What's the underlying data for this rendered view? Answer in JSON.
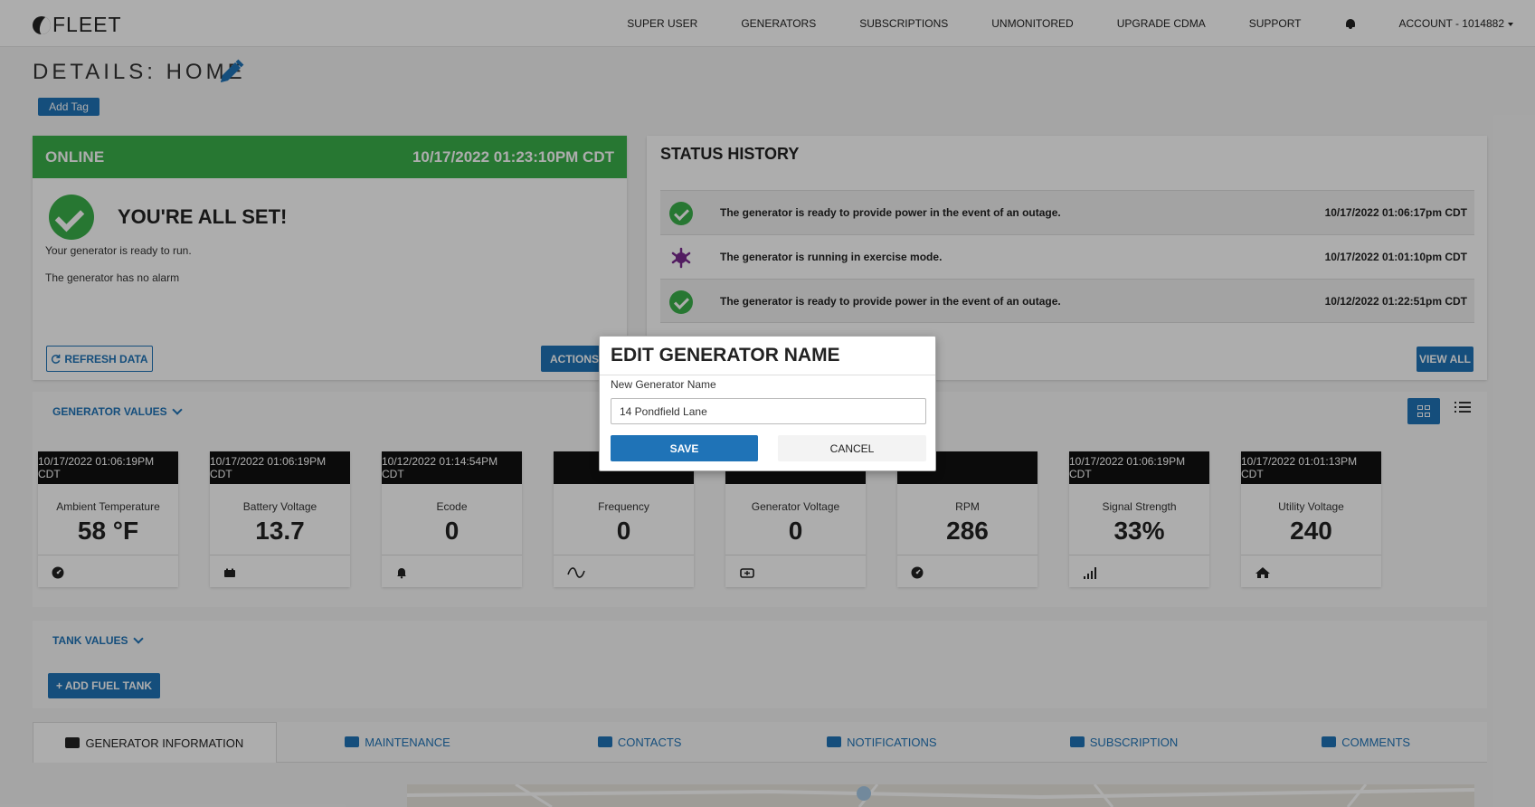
{
  "nav": {
    "logo": "FLEET",
    "items": [
      "SUPER USER",
      "GENERATORS",
      "SUBSCRIPTIONS",
      "UNMONITORED",
      "UPGRADE CDMA",
      "SUPPORT"
    ],
    "account": "ACCOUNT - 1014882"
  },
  "page": {
    "title": "DETAILS: HOME",
    "add_tag": "Add Tag"
  },
  "status_card": {
    "status": "ONLINE",
    "timestamp": "10/17/2022 01:23:10PM CDT",
    "headline": "YOU'RE ALL SET!",
    "ready_text": "Your generator is ready to run.",
    "alarm_text": "The generator has no alarm",
    "refresh_label": "REFRESH DATA",
    "actions_label": "ACTIONS",
    "status_color": "#3ab04a"
  },
  "status_history": {
    "title": "STATUS HISTORY",
    "view_all": "VIEW ALL",
    "rows": [
      {
        "icon": "check-icon",
        "text": "The generator is ready to provide power in the event of an outage.",
        "time": "10/17/2022 01:06:17pm CDT"
      },
      {
        "icon": "exercise-icon",
        "text": "The generator is running in exercise mode.",
        "time": "10/17/2022 01:01:10pm CDT"
      },
      {
        "icon": "check-icon",
        "text": "The generator is ready to provide power in the event of an outage.",
        "time": "10/12/2022 01:22:51pm CDT"
      }
    ]
  },
  "generator_values": {
    "label": "GENERATOR VALUES",
    "tiles": [
      {
        "time": "10/17/2022 01:06:19PM CDT",
        "label": "Ambient Temperature",
        "value": "58 °F",
        "icon": "gauge-icon"
      },
      {
        "time": "10/17/2022 01:06:19PM CDT",
        "label": "Battery Voltage",
        "value": "13.7",
        "icon": "battery-icon"
      },
      {
        "time": "10/12/2022 01:14:54PM CDT",
        "label": "Ecode",
        "value": "0",
        "icon": "bell-icon"
      },
      {
        "time": "",
        "label": "Frequency",
        "value": "0",
        "icon": "wave-icon"
      },
      {
        "time": "",
        "label": "Generator Voltage",
        "value": "0",
        "icon": "car-battery-icon"
      },
      {
        "time": "",
        "label": "RPM",
        "value": "286",
        "icon": "gauge-icon"
      },
      {
        "time": "10/17/2022 01:06:19PM CDT",
        "label": "Signal Strength",
        "value": "33%",
        "icon": "signal-icon"
      },
      {
        "time": "10/17/2022 01:01:13PM CDT",
        "label": "Utility Voltage",
        "value": "240",
        "icon": "home-icon"
      }
    ]
  },
  "tank_values": {
    "label": "TANK VALUES",
    "add_fuel_tank": "ADD FUEL TANK"
  },
  "tabs": [
    "GENERATOR INFORMATION",
    "MAINTENANCE",
    "CONTACTS",
    "NOTIFICATIONS",
    "SUBSCRIPTION",
    "COMMENTS"
  ],
  "modal": {
    "title": "EDIT GENERATOR NAME",
    "field_label": "New Generator Name",
    "field_value": "14 Pondfield Lane",
    "save": "SAVE",
    "cancel": "CANCEL"
  },
  "colors": {
    "primary": "#1f73b7",
    "success": "#3ab04a",
    "exercise": "#7a2a8f"
  }
}
